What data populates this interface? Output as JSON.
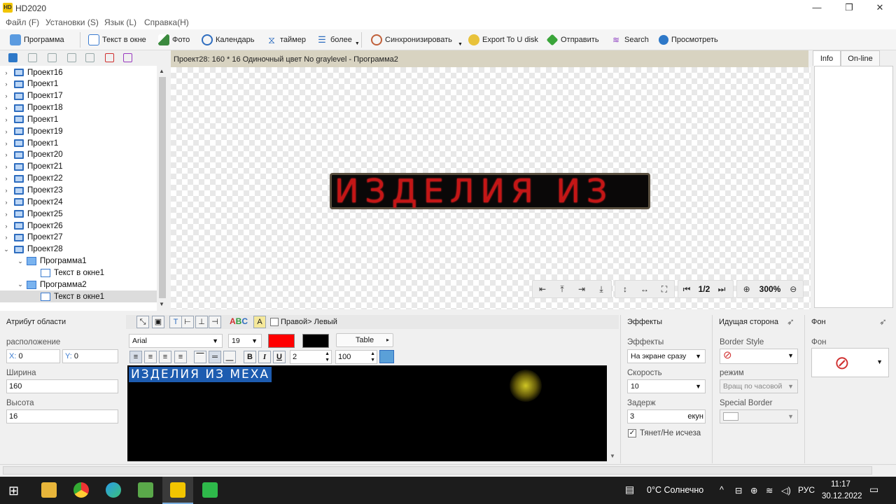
{
  "window": {
    "title": "HD2020"
  },
  "menu": [
    "Файл (F)",
    "Установки (S)",
    "Язык (L)",
    "Справка(H)"
  ],
  "toolbar": {
    "program": "Программа",
    "text_window": "Текст в окне",
    "photo": "Фото",
    "calendar": "Календарь",
    "timer": "таймер",
    "more": "более",
    "sync": "Синхронизировать",
    "export": "Export To U disk",
    "send": "Отправить",
    "search": "Search",
    "preview": "Просмотреть"
  },
  "tree": {
    "items": [
      {
        "label": "Проект16",
        "type": "project",
        "expanded": false
      },
      {
        "label": "Проект1",
        "type": "project",
        "expanded": false
      },
      {
        "label": "Проект17",
        "type": "project",
        "expanded": false
      },
      {
        "label": "Проект18",
        "type": "project",
        "expanded": false
      },
      {
        "label": "Проект1",
        "type": "project",
        "expanded": false
      },
      {
        "label": "Проект19",
        "type": "project",
        "expanded": false
      },
      {
        "label": "Проект1",
        "type": "project",
        "expanded": false
      },
      {
        "label": "Проект20",
        "type": "project",
        "expanded": false
      },
      {
        "label": "Проект21",
        "type": "project",
        "expanded": false
      },
      {
        "label": "Проект22",
        "type": "project",
        "expanded": false
      },
      {
        "label": "Проект23",
        "type": "project",
        "expanded": false
      },
      {
        "label": "Проект24",
        "type": "project",
        "expanded": false
      },
      {
        "label": "Проект25",
        "type": "project",
        "expanded": false
      },
      {
        "label": "Проект26",
        "type": "project",
        "expanded": false
      },
      {
        "label": "Проект27",
        "type": "project",
        "expanded": false
      },
      {
        "label": "Проект28",
        "type": "project",
        "expanded": true
      },
      {
        "label": "Программа1",
        "type": "program",
        "expanded": true
      },
      {
        "label": "Текст в окне1",
        "type": "text"
      },
      {
        "label": "Программа2",
        "type": "program",
        "expanded": true
      },
      {
        "label": "Текст в окне1",
        "type": "text",
        "selected": true
      }
    ]
  },
  "canvas": {
    "header": "Проект28: 160 * 16 Одиночный цвет No graylevel - Программа2",
    "led_text": "ИЗДЕЛИЯ ИЗ",
    "led_color": "#c41616",
    "page": "1/2",
    "zoom": "300%"
  },
  "info": {
    "tabs": [
      "Info",
      "On-line"
    ]
  },
  "area_attr": {
    "title": "Атрибут области",
    "position_label": "расположение",
    "x_label": "X:",
    "x_value": "0",
    "y_label": "Y:",
    "y_value": "0",
    "width_label": "Ширина",
    "width_value": "160",
    "height_label": "Высота",
    "height_value": "16"
  },
  "text_editor": {
    "direction_label": "Правой> Левый",
    "font": "Arial",
    "font_size": "19",
    "text_color": "#ff0000",
    "bg_color": "#000000",
    "table_label": "Table",
    "spacing_value": "2",
    "scale_value": "100",
    "text": "ИЗДЕЛИЯ ИЗ МЕХА"
  },
  "effects": {
    "title": "Эффекты",
    "effects_label": "Эффекты",
    "effects_value": "На экране сразу",
    "speed_label": "Скорость",
    "speed_value": "10",
    "delay_label": "Задерж",
    "delay_value": "3",
    "delay_unit": "екун",
    "stretch_label": "Тянет/Не исчеза"
  },
  "border": {
    "title": "Идущая сторона",
    "style_label": "Border Style",
    "mode_label": "режим",
    "mode_value": "Вращ по часовой",
    "special_label": "Special Border"
  },
  "background": {
    "title": "Фон",
    "bg_label": "Фон"
  },
  "taskbar": {
    "weather": "0°C  Солнечно",
    "lang": "РУС",
    "time": "11:17",
    "date": "30.12.2022"
  }
}
